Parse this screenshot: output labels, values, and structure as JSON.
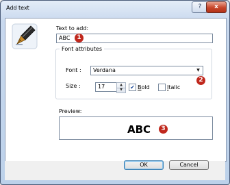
{
  "window": {
    "title": "Add text"
  },
  "titlebar": {
    "help_label": "?",
    "close_label": "x"
  },
  "text_field": {
    "label": "Text to add:",
    "value": "ABC",
    "badge": "1"
  },
  "font_attributes": {
    "group_title": "Font attributes",
    "font_label": "Font :",
    "font_value": "Verdana",
    "size_label": "Size :",
    "size_value": "17",
    "bold_label": "Bold",
    "bold_checked": true,
    "italic_label": "Italic",
    "italic_checked": false,
    "badge": "2"
  },
  "preview": {
    "label": "Preview:",
    "text": "ABC",
    "badge": "3"
  },
  "buttons": {
    "ok_label": "OK",
    "cancel_label": "Cancel"
  }
}
